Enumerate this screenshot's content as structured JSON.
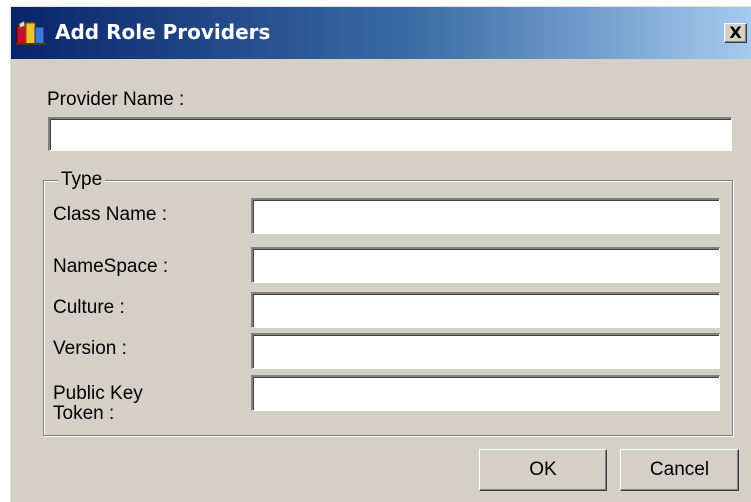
{
  "dialog": {
    "title": "Add Role Providers",
    "title_icon": "books-icon",
    "close_label": "X"
  },
  "form": {
    "provider_name_label": "Provider Name :",
    "provider_name_value": "",
    "type_group": {
      "legend": "Type",
      "fields": [
        {
          "label": "Class Name :",
          "value": ""
        },
        {
          "label": "NameSpace :",
          "value": ""
        },
        {
          "label": "Culture :",
          "value": ""
        },
        {
          "label": "Version :",
          "value": ""
        },
        {
          "label": "Public Key Token :",
          "value": ""
        }
      ]
    }
  },
  "buttons": {
    "ok_label": "OK",
    "cancel_label": "Cancel"
  },
  "colors": {
    "titlebar_start": "#0a246a",
    "titlebar_end": "#a6caf0",
    "face": "#d4d0c8"
  }
}
